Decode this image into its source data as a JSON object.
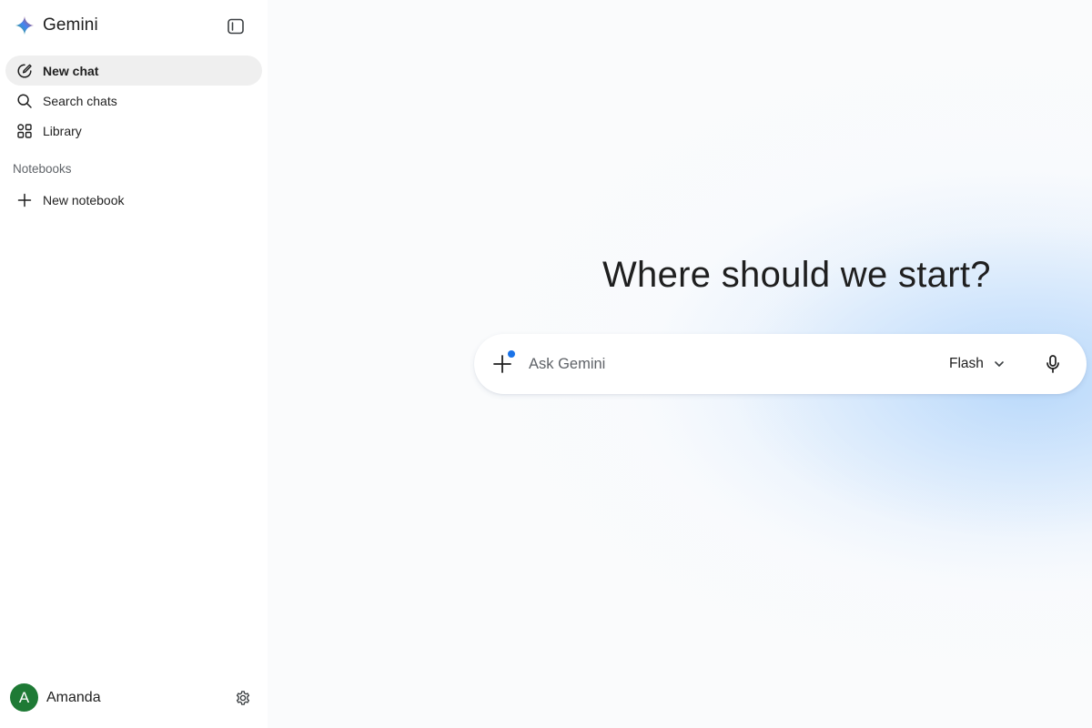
{
  "app": {
    "name": "Gemini"
  },
  "sidebar": {
    "items": [
      {
        "label": "New chat",
        "icon": "edit-icon"
      },
      {
        "label": "Search chats",
        "icon": "search-icon"
      },
      {
        "label": "Library",
        "icon": "library-icon"
      }
    ],
    "notebooks_title": "Notebooks",
    "notebook_items": [
      {
        "label": "New notebook",
        "icon": "plus-icon"
      }
    ]
  },
  "profile": {
    "initial": "A",
    "name": "Amanda"
  },
  "main": {
    "greeting": "Where should we start?",
    "prompt": {
      "placeholder": "Ask Gemini",
      "value": "",
      "model": "Flash"
    }
  },
  "colors": {
    "accent": "#1a73e8",
    "avatar": "#1e7a35",
    "active_nav_bg": "#efefef"
  }
}
